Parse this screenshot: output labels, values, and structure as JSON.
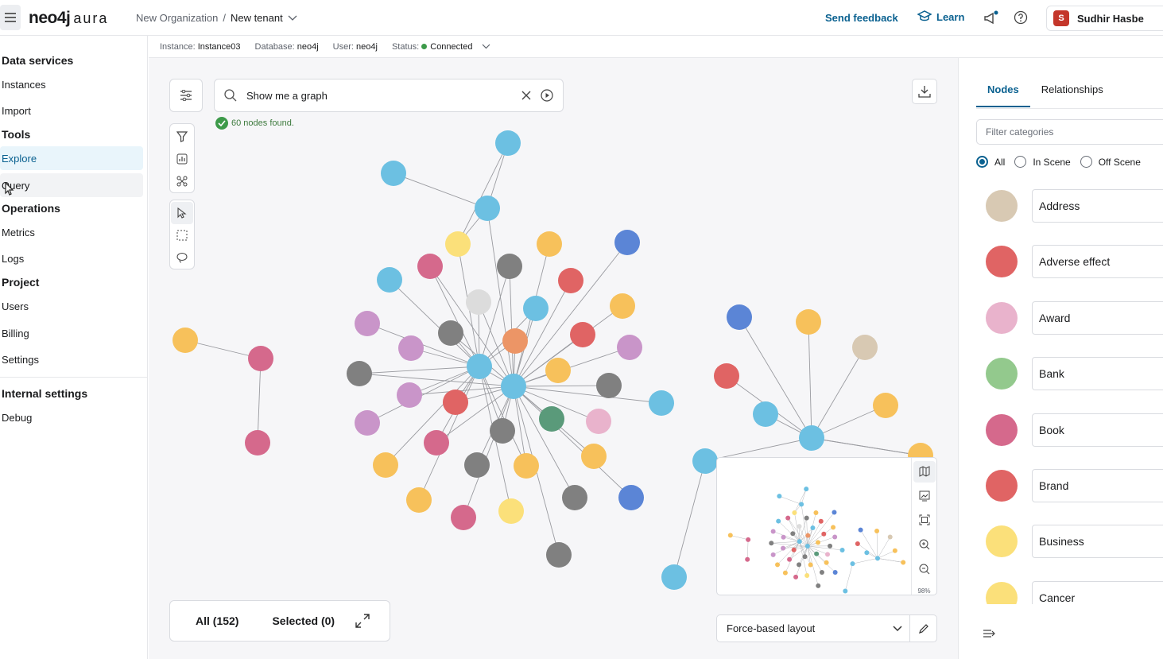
{
  "topbar": {
    "logo_main": "neo4j",
    "logo_sub": "aura",
    "org": "New Organization",
    "sep": "/",
    "tenant": "New tenant",
    "feedback": "Send feedback",
    "learn": "Learn",
    "user_initial": "S",
    "user_name": "Sudhir Hasbe"
  },
  "sidebar": {
    "sections": {
      "data_services": "Data services",
      "tools": "Tools",
      "operations": "Operations",
      "project": "Project",
      "internal": "Internal settings"
    },
    "items": {
      "instances": "Instances",
      "import": "Import",
      "explore": "Explore",
      "query": "Query",
      "metrics": "Metrics",
      "logs": "Logs",
      "users": "Users",
      "billing": "Billing",
      "settings": "Settings",
      "debug": "Debug"
    }
  },
  "infobar": {
    "instance_label": "Instance:",
    "instance_value": "Instance03",
    "database_label": "Database:",
    "database_value": "neo4j",
    "user_label": "User:",
    "user_value": "neo4j",
    "status_label": "Status:",
    "status_value": "Connected"
  },
  "search": {
    "query": "Show me a graph",
    "result": "60 nodes found."
  },
  "counts": {
    "all": "All (152)",
    "selected": "Selected (0)"
  },
  "layout": {
    "selected": "Force-based layout"
  },
  "minimap": {
    "zoom": "98%"
  },
  "panel": {
    "tabs": [
      "Nodes",
      "Relationships"
    ],
    "filter_placeholder": "Filter categories",
    "radios": [
      "All",
      "In Scene",
      "Off Scene"
    ],
    "categories": [
      {
        "name": "Address",
        "color": "#d8c9b3"
      },
      {
        "name": "Adverse effect",
        "color": "#e06464"
      },
      {
        "name": "Award",
        "color": "#e9b3cc"
      },
      {
        "name": "Bank",
        "color": "#93c98d"
      },
      {
        "name": "Book",
        "color": "#d5698c"
      },
      {
        "name": "Brand",
        "color": "#e06464"
      },
      {
        "name": "Business",
        "color": "#fbe07a"
      },
      {
        "name": "Cancer",
        "color": "#fbe07a"
      }
    ]
  },
  "graph": {
    "colors": {
      "blue": "#6cc0e2",
      "orange": "#f7c15b",
      "red": "#e06464",
      "gray": "#808080",
      "purple": "#c995c9",
      "pink": "#d5698c",
      "dark_blue": "#5b85d6",
      "light_gray": "#dcdcdc",
      "tan": "#d8c9b3",
      "teal": "#5a9a7a",
      "yellow": "#fbe07a",
      "light_pink": "#e9b3cc",
      "salmon": "#ec9566"
    }
  }
}
